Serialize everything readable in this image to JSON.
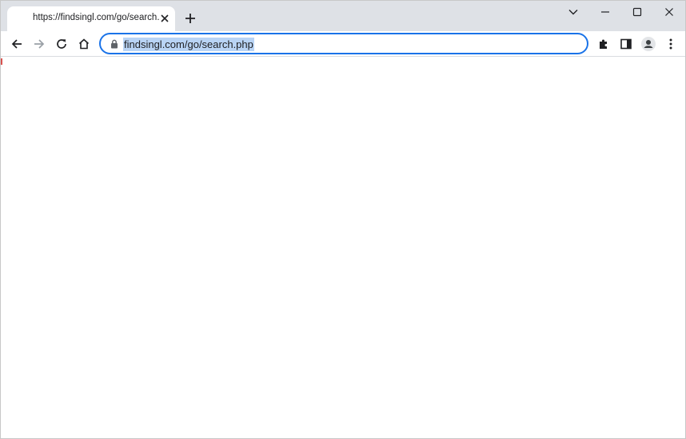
{
  "browser": {
    "tab": {
      "title": "https://findsingl.com/go/search.php"
    },
    "address_bar": {
      "url": "findsingl.com/go/search.php"
    }
  },
  "colors": {
    "accent": "#1a73e8",
    "selection": "#b9d4f5",
    "chrome_bg": "#dee1e6"
  }
}
